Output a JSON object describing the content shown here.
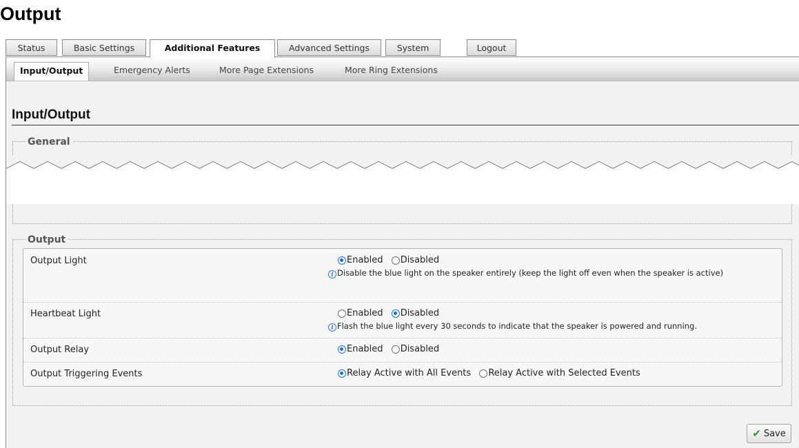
{
  "doc_title": "Output",
  "top_tabs": [
    {
      "label": "Status",
      "active": false
    },
    {
      "label": "Basic Settings",
      "active": false
    },
    {
      "label": "Additional Features",
      "active": true
    },
    {
      "label": "Advanced Settings",
      "active": false
    },
    {
      "label": "System",
      "active": false
    },
    {
      "label": "Logout",
      "active": false
    }
  ],
  "sub_tabs": [
    {
      "label": "Input/Output",
      "active": true
    },
    {
      "label": "Emergency Alerts",
      "active": false
    },
    {
      "label": "More Page Extensions",
      "active": false
    },
    {
      "label": "More Ring Extensions",
      "active": false
    }
  ],
  "page_heading": "Input/Output",
  "general_section": {
    "legend": "General"
  },
  "output_section": {
    "legend": "Output",
    "rows": [
      {
        "label": "Output Light",
        "options": [
          {
            "label": "Enabled",
            "checked": true
          },
          {
            "label": "Disabled",
            "checked": false
          }
        ],
        "help": "Disable the blue light on the speaker entirely (keep the light off even when the speaker is active)"
      },
      {
        "label": "Heartbeat Light",
        "options": [
          {
            "label": "Enabled",
            "checked": false
          },
          {
            "label": "Disabled",
            "checked": true
          }
        ],
        "help": "Flash the blue light every 30 seconds to indicate that the speaker is powered and running."
      },
      {
        "label": "Output Relay",
        "options": [
          {
            "label": "Enabled",
            "checked": true
          },
          {
            "label": "Disabled",
            "checked": false
          }
        ]
      },
      {
        "label": "Output Triggering Events",
        "options": [
          {
            "label": "Relay Active with All Events",
            "checked": true
          },
          {
            "label": "Relay Active with Selected Events",
            "checked": false
          }
        ]
      }
    ]
  },
  "save_button": {
    "label": "Save"
  },
  "colors": {
    "accent": "#1a6fd6",
    "panel_bg": "#f2f2f2",
    "save_check": "#2e9a2e"
  }
}
